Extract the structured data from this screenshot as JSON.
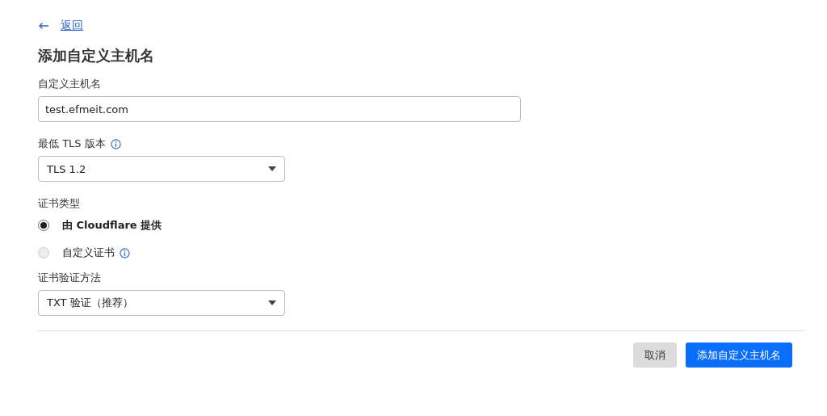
{
  "back_link": "返回",
  "title": "添加自定义主机名",
  "hostname_field": {
    "label": "自定义主机名",
    "value": "test.efmeit.com"
  },
  "tls_field": {
    "label": "最低 TLS 版本",
    "info": true,
    "value": "TLS 1.2"
  },
  "certificate_type": {
    "label": "证书类型",
    "options": [
      {
        "label": "由 Cloudflare 提供",
        "selected": true,
        "info": false
      },
      {
        "label": "自定义证书",
        "selected": false,
        "info": true
      }
    ]
  },
  "validation_field": {
    "label": "证书验证方法",
    "info": false,
    "value": "TXT 验证（推荐）"
  },
  "buttons": [
    {
      "label": "取消",
      "kind": "secondary"
    },
    {
      "label": "添加自定义主机名",
      "kind": "primary"
    }
  ]
}
